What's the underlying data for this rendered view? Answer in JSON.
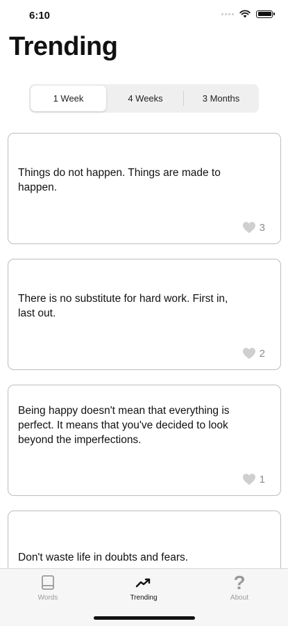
{
  "status_bar": {
    "time": "6:10"
  },
  "page": {
    "title": "Trending"
  },
  "period_selector": {
    "options": [
      "1 Week",
      "4 Weeks",
      "3 Months"
    ],
    "selected": "1 Week"
  },
  "cards": [
    {
      "text": "Things do not happen. Things are made to happen.",
      "likes": "3"
    },
    {
      "text": "There is no substitute for hard work. First in, last out.",
      "likes": "2"
    },
    {
      "text": "Being happy doesn't mean that everything is perfect. It means that you've decided to look beyond the imperfections.",
      "likes": "1"
    },
    {
      "text": "Don't waste life in doubts and fears.",
      "likes": ""
    }
  ],
  "tab_bar": {
    "tabs": [
      {
        "label": "Words",
        "icon": "book-icon"
      },
      {
        "label": "Trending",
        "icon": "trending-up-icon"
      },
      {
        "label": "About",
        "icon": "question-mark-icon"
      }
    ],
    "active": "Trending"
  },
  "colors": {
    "accent": "#111111",
    "inactive": "#9a9a9a",
    "heart": "#cfcfcf"
  }
}
